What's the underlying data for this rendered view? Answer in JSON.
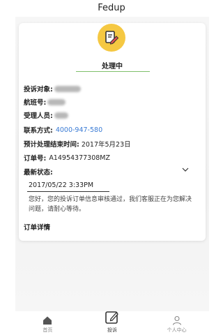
{
  "app": {
    "title": "Fedup"
  },
  "status": {
    "text": "处理中",
    "icon": "pencil-document-icon",
    "color": "#f5c842"
  },
  "details": {
    "complaint_target_label": "投诉对象:",
    "flight_no_label": "航班号:",
    "handler_label": "受理人员:",
    "contact_label": "联系方式:",
    "contact_value": "4000-947-580",
    "eta_label": "预计处理结束时间:",
    "eta_value": "2017年5月23日",
    "order_no_label": "订单号:",
    "order_no_value": "A14954377308MZ",
    "latest_status_label": "最新状态:"
  },
  "latest_update": {
    "time": "2017/05/22 3:33PM",
    "message": "您好，您的投诉订单信息审核通过，我们客服正在为您解决问题，请耐心等待。"
  },
  "order_detail_label": "订单详情",
  "tabs": [
    {
      "label": "首页",
      "icon": "home-icon"
    },
    {
      "label": "投诉",
      "icon": "edit-icon"
    },
    {
      "label": "个人中心",
      "icon": "user-icon"
    }
  ],
  "colors": {
    "accent": "#f5c842",
    "link": "#3a7bd5",
    "divider": "#7fbf6a"
  }
}
